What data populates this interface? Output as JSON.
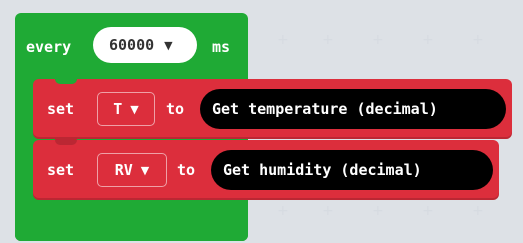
{
  "colors": {
    "loop_block": "#1faa35",
    "variable_block": "#dc2e3c",
    "reporter_block": "#000000",
    "workspace": "#f3f4f5"
  },
  "every_block": {
    "label": "every",
    "interval_value": "60000",
    "interval_caret": "▼",
    "unit": "ms"
  },
  "statements": [
    {
      "set_label": "set",
      "variable": "T",
      "caret": "▼",
      "to_label": "to",
      "value_block": "Get temperature (decimal)"
    },
    {
      "set_label": "set",
      "variable": "RV",
      "caret": "▼",
      "to_label": "to",
      "value_block": "Get humidity (decimal)"
    }
  ],
  "icons": {
    "dropdown": "chevron-down-icon",
    "grid": "plus-icon"
  }
}
